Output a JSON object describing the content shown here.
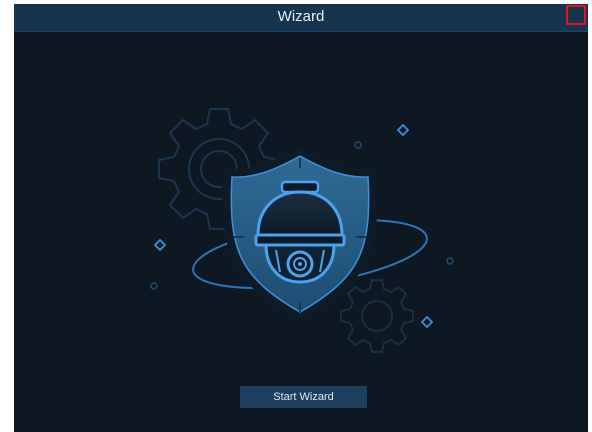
{
  "window": {
    "title": "Wizard"
  },
  "illustration": {
    "subject": "security-camera-shield-icon"
  },
  "actions": {
    "start_label": "Start Wizard"
  },
  "colors": {
    "background": "#0e1823",
    "titlebar": "#17344f",
    "accent": "#3f8fd9",
    "close_highlight": "#e0141b",
    "button": "#1d3e5c"
  }
}
